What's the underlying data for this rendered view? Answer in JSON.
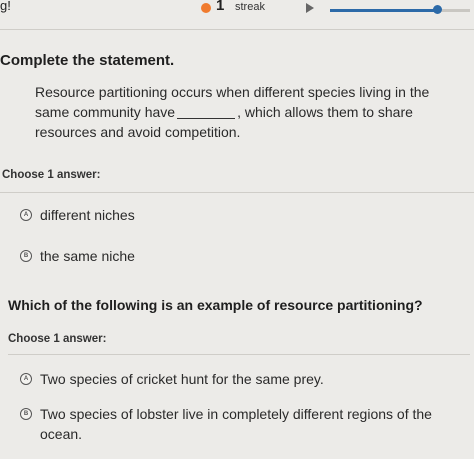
{
  "header": {
    "partial_word": "g!",
    "streak_count": "1",
    "streak_label": "streak",
    "progress_fraction": 0.75
  },
  "section1": {
    "title": "Complete the statement.",
    "statement_before_blank": "Resource partitioning occurs when different species living in the same community have",
    "statement_after_blank": ", which allows them to share resources and avoid competition.",
    "choose_label": "Choose 1 answer:",
    "options": [
      {
        "letter": "A",
        "text": "different niches"
      },
      {
        "letter": "B",
        "text": "the same niche"
      }
    ]
  },
  "section2": {
    "question": "Which of the following is an example of resource partitioning?",
    "choose_label": "Choose 1 answer:",
    "options": [
      {
        "letter": "A",
        "text": "Two species of cricket hunt for the same prey."
      },
      {
        "letter": "B",
        "text": "Two species of lobster live in completely different regions of the ocean."
      }
    ]
  },
  "colors": {
    "streak": "#f07b2e",
    "progress": "#2c6aa8",
    "background": "#ecebe8"
  }
}
